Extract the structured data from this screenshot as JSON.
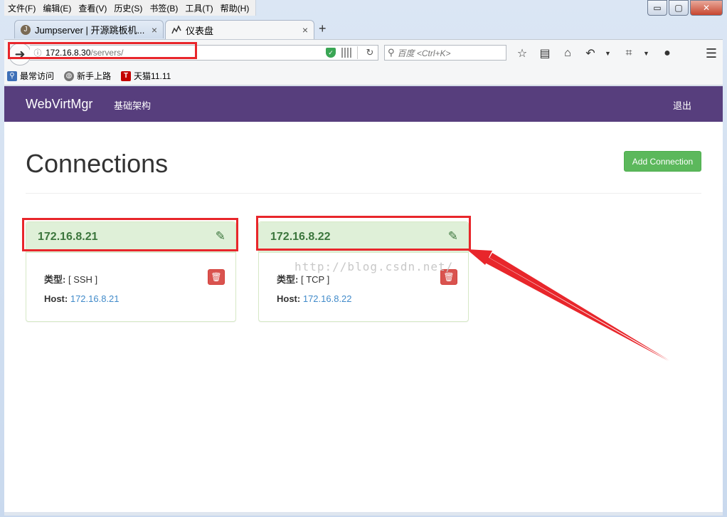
{
  "menu": [
    "文件(F)",
    "编辑(E)",
    "查看(V)",
    "历史(S)",
    "书签(B)",
    "工具(T)",
    "帮助(H)"
  ],
  "window_controls": {
    "minimize": "▭",
    "maximize": "▢",
    "close": "✕"
  },
  "tabs": [
    {
      "label": "Jumpserver | 开源跳板机...",
      "icon": "jumpserver-favicon",
      "close": "×"
    },
    {
      "label": "仪表盘",
      "icon": "dashboard-favicon",
      "close": "×"
    }
  ],
  "new_tab": "+",
  "address": {
    "host": "172.16.8.30",
    "path": "/servers/"
  },
  "search": {
    "placeholder": "百度 <Ctrl+K>"
  },
  "bookmarks": [
    {
      "label": "最常访问",
      "icon": "most-visited-icon"
    },
    {
      "label": "新手上路",
      "icon": "globe-icon"
    },
    {
      "label": "天猫11.11",
      "icon": "tmall-icon",
      "glyph": "T"
    }
  ],
  "app": {
    "brand": "WebVirtMgr",
    "nav_link": "基础架构",
    "logout": "退出",
    "page_title": "Connections",
    "add_button": "Add Connection"
  },
  "connections": [
    {
      "name": "172.16.8.21",
      "type_label": "类型:",
      "type": "[ SSH ]",
      "host_label": "Host:",
      "host": "172.16.8.21"
    },
    {
      "name": "172.16.8.22",
      "type_label": "类型:",
      "type": "[ TCP ]",
      "host_label": "Host:",
      "host": "172.16.8.22"
    }
  ],
  "watermark": "http://blog.csdn.net/",
  "colors": {
    "navbar": "#573e7d",
    "success": "#5cb85c",
    "danger": "#d9534f",
    "panel_head": "#dff0d8",
    "annotation": "#e8262b"
  }
}
